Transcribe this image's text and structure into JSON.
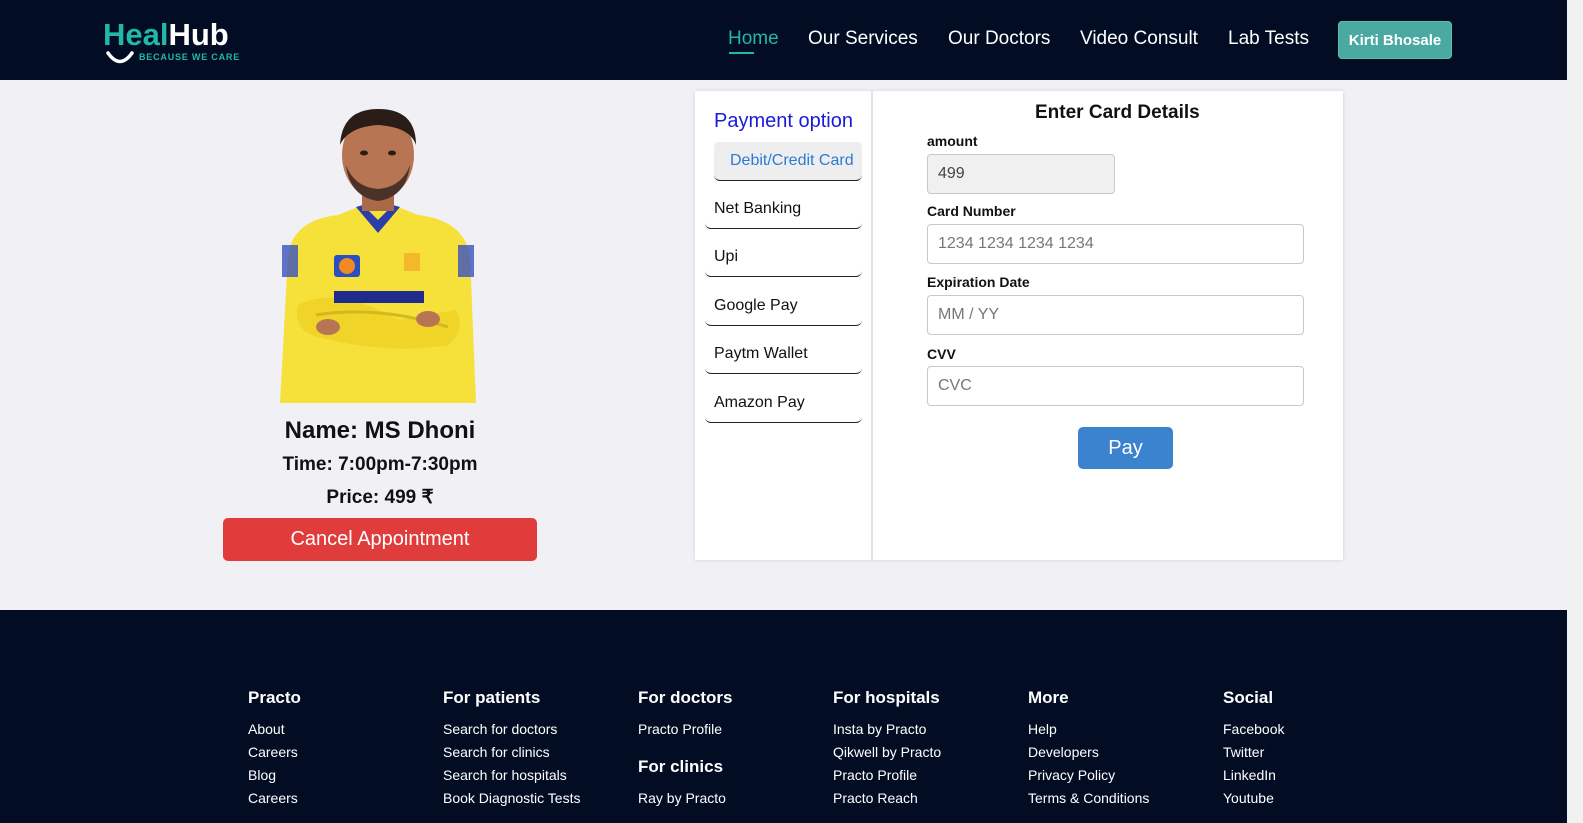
{
  "header": {
    "logo": {
      "part1": "Heal",
      "part2": "Hub",
      "tagline": "BECAUSE WE CARE"
    },
    "nav": [
      {
        "label": "Home",
        "active": true
      },
      {
        "label": "Our Services"
      },
      {
        "label": "Our Doctors"
      },
      {
        "label": "Video Consult"
      },
      {
        "label": "Lab Tests"
      }
    ],
    "user": "Kirti Bhosale",
    "accent_color": "#22b7a8",
    "background_color": "#020d24"
  },
  "doctor": {
    "name": "Name: MS Dhoni",
    "time": "Time: 7:00pm-7:30pm",
    "price": "Price: 499 ₹",
    "cancel_label": "Cancel Appointment",
    "photo": "doctor-photo-yellow-jersey"
  },
  "payment": {
    "options_title": "Payment option",
    "options": [
      "Debit/Credit Card",
      "Net Banking",
      "Upi",
      "Google Pay",
      "Paytm Wallet",
      "Amazon Pay"
    ],
    "selected_option": "Debit/Credit Card",
    "card_title": "Enter Card Details",
    "amount": {
      "label": "amount",
      "value": "499"
    },
    "card_number": {
      "label": "Card Number",
      "placeholder": "1234 1234 1234 1234"
    },
    "expiry": {
      "label": "Expiration Date",
      "placeholder": "MM / YY"
    },
    "cvv": {
      "label": "CVV",
      "placeholder": "CVC"
    },
    "pay_label": "Pay",
    "pay_color": "#3b82cf",
    "cancel_color": "#e13c3c"
  },
  "footer": {
    "columns": [
      {
        "heading": "Practo",
        "links": [
          "About",
          "Careers",
          "Blog",
          "Careers"
        ]
      },
      {
        "heading": "For patients",
        "links": [
          "Search for doctors",
          "Search for clinics",
          "Search for hospitals",
          "Book Diagnostic Tests"
        ]
      },
      {
        "heading": "For doctors",
        "links": [
          "Practo Profile"
        ],
        "heading2": "For clinics",
        "links2": [
          "Ray by Practo"
        ]
      },
      {
        "heading": "For hospitals",
        "links": [
          "Insta by Practo",
          "Qikwell by Practo",
          "Practo Profile",
          "Practo Reach"
        ]
      },
      {
        "heading": "More",
        "links": [
          "Help",
          "Developers",
          "Privacy Policy",
          "Terms & Conditions"
        ]
      },
      {
        "heading": "Social",
        "links": [
          "Facebook",
          "Twitter",
          "LinkedIn",
          "Youtube"
        ]
      }
    ]
  }
}
